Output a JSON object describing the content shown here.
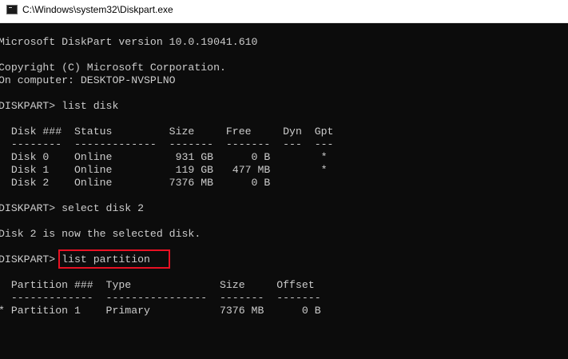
{
  "window": {
    "title": "C:\\Windows\\system32\\Diskpart.exe",
    "icon": "console-window-icon"
  },
  "console": {
    "lines": [
      "Microsoft DiskPart version 10.0.19041.610",
      "",
      "Copyright (C) Microsoft Corporation.",
      "On computer: DESKTOP-NVSPLNO",
      "",
      "DISKPART> list disk",
      "",
      "  Disk ###  Status         Size     Free     Dyn  Gpt",
      "  --------  -------------  -------  -------  ---  ---",
      "  Disk 0    Online          931 GB      0 B        *",
      "  Disk 1    Online          119 GB   477 MB        *",
      "  Disk 2    Online         7376 MB      0 B",
      "",
      "DISKPART> select disk 2",
      "",
      "Disk 2 is now the selected disk.",
      "",
      "DISKPART> list partition",
      "",
      "  Partition ###  Type              Size     Offset",
      "  -------------  ----------------  -------  -------",
      "* Partition 1    Primary           7376 MB      0 B"
    ]
  },
  "colors": {
    "console_background": "#0c0c0c",
    "console_text": "#cccccc",
    "highlight_border": "#e81123",
    "titlebar_background": "#ffffff"
  }
}
